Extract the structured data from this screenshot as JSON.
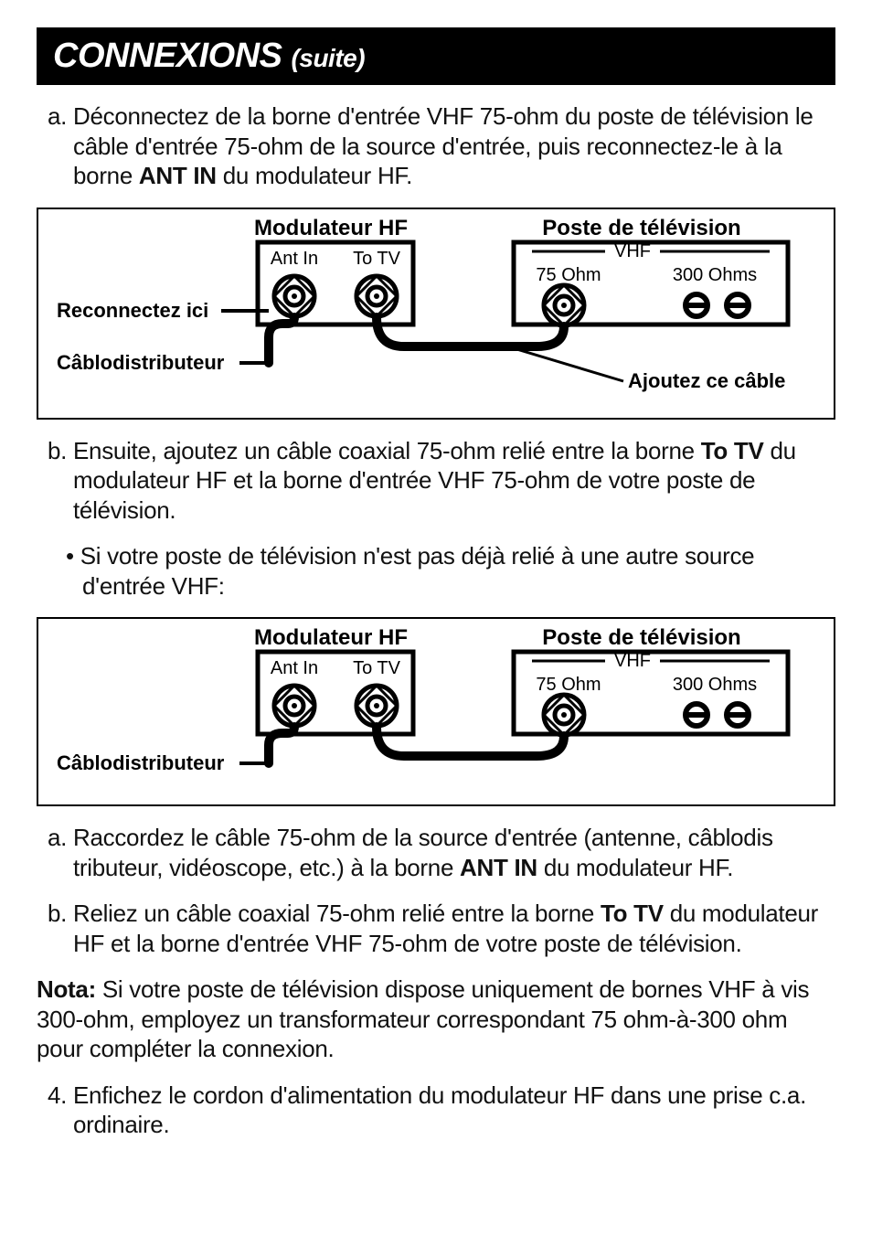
{
  "title": {
    "main": "CONNEXIONS",
    "sub": "(suite)"
  },
  "step_a1_pre": "a. Déconnectez de la borne d'entrée VHF 75-ohm du poste de télévision le câble d'entrée 75-ohm de la source d'entrée, puis reconnectez-le à la borne ",
  "step_a1_bold": "ANT IN",
  "step_a1_post": " du modulateur HF.",
  "diagram_labels": {
    "modulator": "Modulateur HF",
    "tv": "Poste de télévision",
    "vhf": "VHF",
    "ant_in": "Ant In",
    "to_tv": "To TV",
    "ohm75": "75 Ohm",
    "ohm300": "300 Ohms",
    "reconnect": "Reconnectez ici",
    "cable_co": "Câblodistributeur",
    "add_cable": "Ajoutez ce câble"
  },
  "step_b1_pre": "b. Ensuite, ajoutez un câble coaxial 75-ohm relié entre la borne ",
  "step_b1_bold": "To TV",
  "step_b1_post": " du modulateur HF et la borne d'entrée VHF 75-ohm de votre poste de télévision.",
  "bullet1": "• Si votre poste de télévision n'est pas déjà relié à une autre source d'entrée VHF:",
  "step_a2_pre": "a. Raccordez le câble 75-ohm de la source d'entrée (antenne, câblodis tributeur, vidéoscope, etc.) à la borne ",
  "step_a2_bold": "ANT IN",
  "step_a2_post": " du modulateur HF.",
  "step_b2_pre": "b. Reliez un câble coaxial 75-ohm relié entre la borne ",
  "step_b2_bold": "To TV",
  "step_b2_post": " du modula­teur HF et la borne d'entrée VHF 75-ohm de votre poste de télévision.",
  "nota_bold": "Nota:",
  "nota_text": " Si votre poste de télévision dispose uniquement de bornes VHF à vis 300-ohm, employez un transformateur correspondant 75  ohm-à-300 ohm pour compléter la connexion.",
  "step_4": "4. Enfichez le cordon d'alimentation du modulateur HF dans une prise c.a. ordinaire."
}
